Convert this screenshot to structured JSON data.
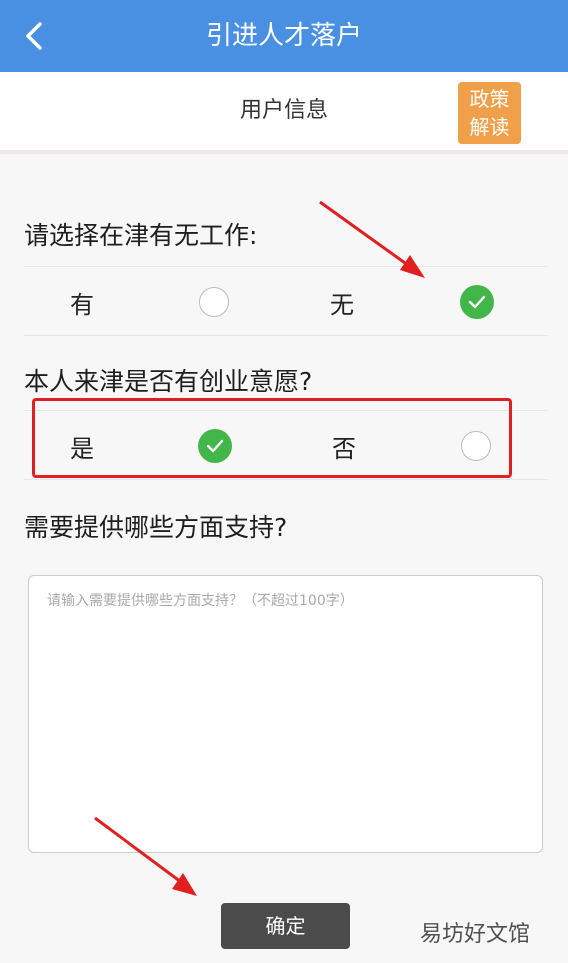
{
  "nav": {
    "title": "引进人才落户"
  },
  "subheader": {
    "title": "用户信息",
    "policy_line1": "政策",
    "policy_line2": "解读"
  },
  "q1": {
    "text": "请选择在津有无工作:",
    "opt_yes": "有",
    "opt_no": "无",
    "selected": "无"
  },
  "q2": {
    "text": "本人来津是否有创业意愿?",
    "opt_yes": "是",
    "opt_no": "否",
    "selected": "是"
  },
  "q3": {
    "text": "需要提供哪些方面支持?",
    "placeholder": "请输入需要提供哪些方面支持？（不超过100字）"
  },
  "confirm": {
    "label": "确定"
  },
  "watermark": {
    "text": "易坊好文馆"
  },
  "colors": {
    "nav": "#4a90e2",
    "accent": "#f0a04b",
    "check": "#43b649",
    "annotation": "#e02020"
  }
}
